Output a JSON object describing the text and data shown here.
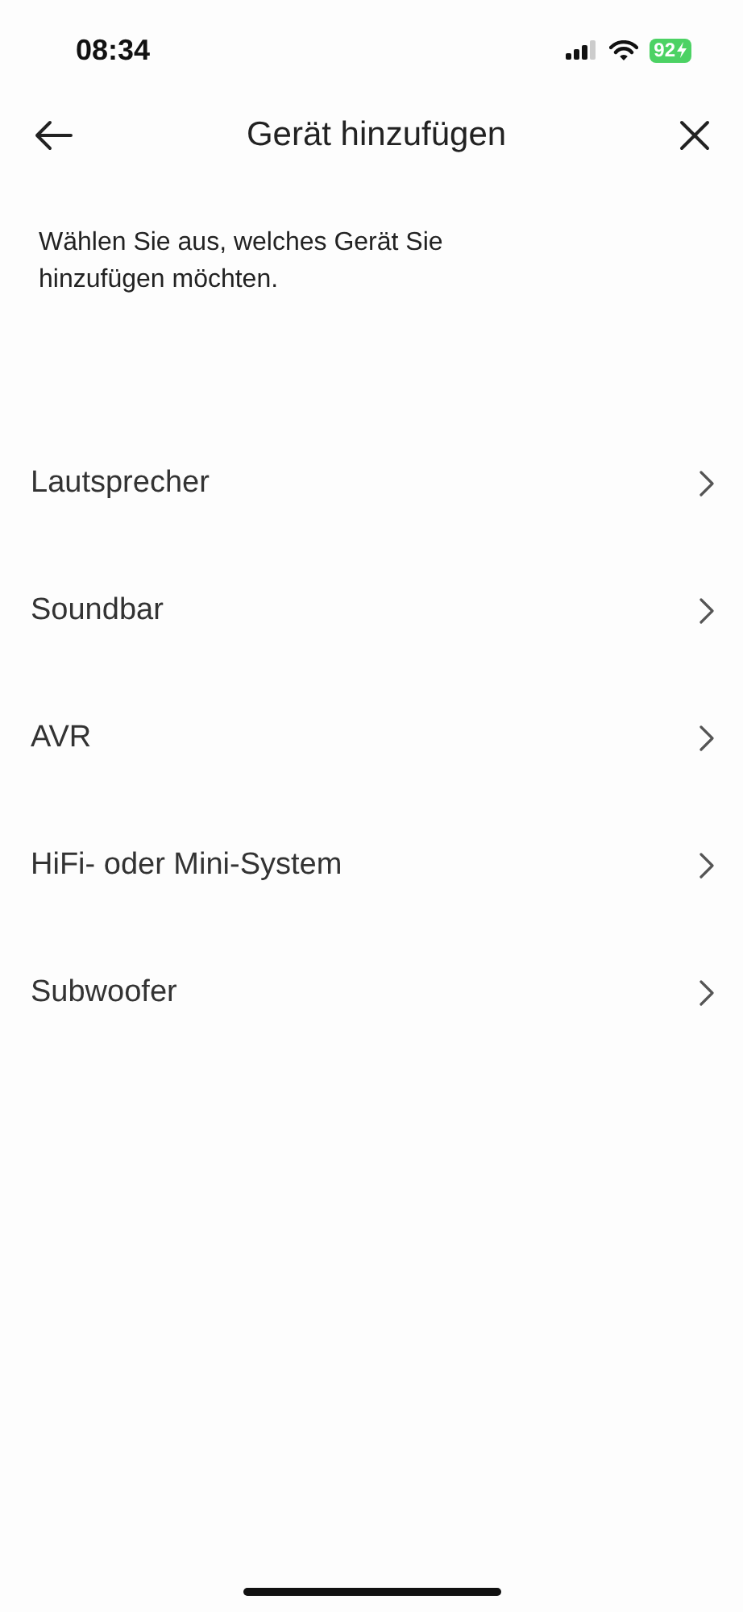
{
  "status_bar": {
    "time": "08:34",
    "battery": "92",
    "charging": true
  },
  "header": {
    "title": "Gerät hinzufügen"
  },
  "description": "Wählen Sie aus, welches Gerät Sie hinzufügen möchten.",
  "devices": [
    {
      "label": "Lautsprecher"
    },
    {
      "label": "Soundbar"
    },
    {
      "label": "AVR"
    },
    {
      "label": "HiFi- oder Mini-System"
    },
    {
      "label": "Subwoofer"
    }
  ]
}
